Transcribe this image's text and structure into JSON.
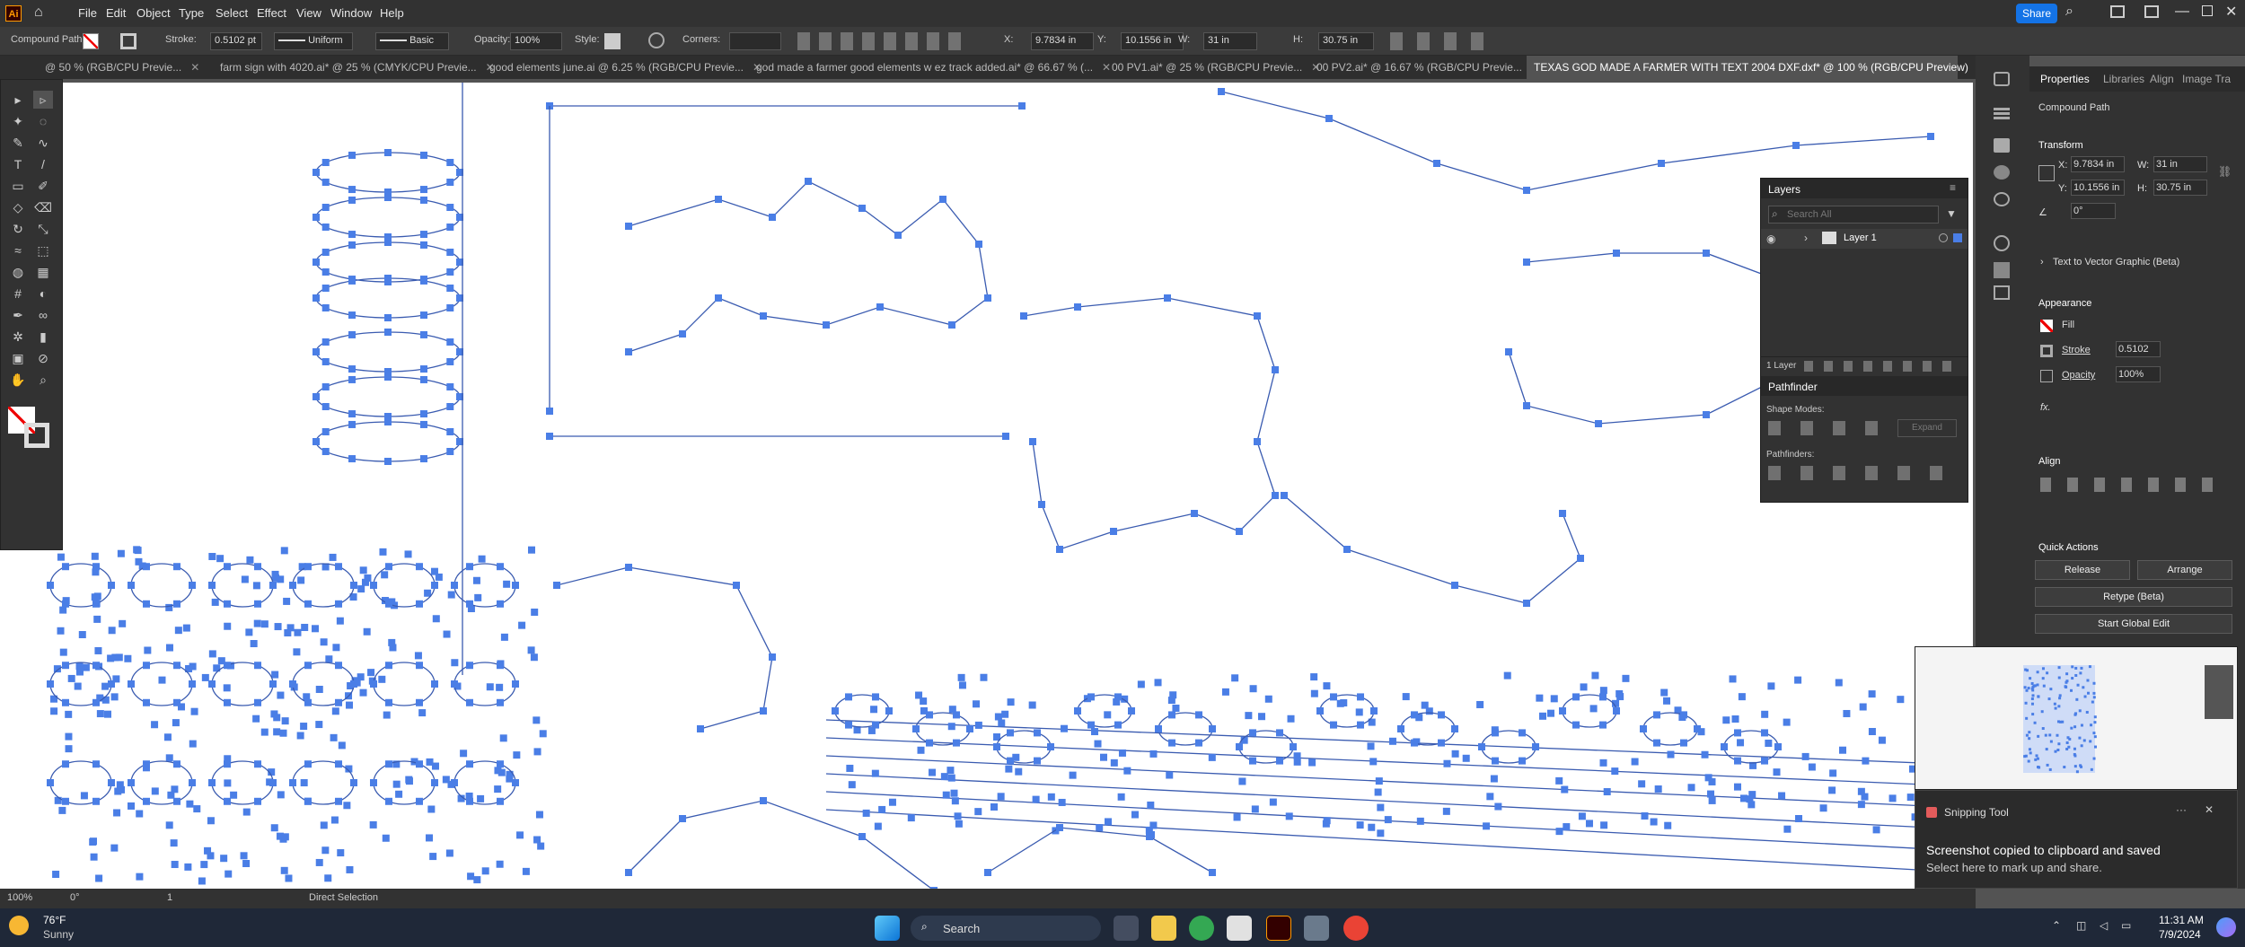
{
  "menu": {
    "app_logo": "Ai",
    "items": [
      "File",
      "Edit",
      "Object",
      "Type",
      "Select",
      "Effect",
      "View",
      "Window",
      "Help"
    ],
    "share_label": "Share"
  },
  "control_bar": {
    "object_type": "Compound Path",
    "stroke_label": "Stroke:",
    "stroke_value": "0.5102 pt",
    "uniform_label": "Uniform",
    "basic_label": "Basic",
    "opacity_label": "Opacity:",
    "opacity_value": "100%",
    "style_label": "Style:",
    "corners_label": "Corners:",
    "x_label": "X:",
    "x_value": "9.7834 in",
    "y_label": "Y:",
    "y_value": "10.1556 in",
    "w_label": "W:",
    "w_value": "31 in",
    "h_label": "H:",
    "h_value": "30.75 in"
  },
  "tabs": [
    {
      "label": "@ 50 % (RGB/CPU Previe..."
    },
    {
      "label": "farm sign with 4020.ai* @ 25 % (CMYK/CPU Previe..."
    },
    {
      "label": "good elements june.ai @ 6.25 % (RGB/CPU Previe..."
    },
    {
      "label": "god made a farmer good elements w ez track added.ai* @ 66.67 % (..."
    },
    {
      "label": "00 PV1.ai* @ 25 % (RGB/CPU Previe..."
    },
    {
      "label": "00 PV2.ai* @ 16.67 % (RGB/CPU Previe..."
    },
    {
      "label": "TEXAS GOD MADE A FARMER WITH TEXT 2004 DXF.dxf* @ 100 % (RGB/CPU Preview)"
    }
  ],
  "tools": [
    "selection-tool",
    "direct-selection-tool",
    "magic-wand-tool",
    "lasso-tool",
    "pen-tool",
    "curvature-tool",
    "type-tool",
    "line-tool",
    "rectangle-tool",
    "paintbrush-tool",
    "shaper-tool",
    "eraser-tool",
    "rotate-tool",
    "scale-tool",
    "width-tool",
    "free-transform-tool",
    "shape-builder-tool",
    "perspective-tool",
    "mesh-tool",
    "gradient-tool",
    "eyedropper-tool",
    "blend-tool",
    "symbol-sprayer-tool",
    "column-graph-tool",
    "artboard-tool",
    "slice-tool",
    "hand-tool",
    "zoom-tool"
  ],
  "status": {
    "zoom": "100%",
    "rotation": "0°",
    "artboard": "1",
    "tool_name": "Direct Selection"
  },
  "properties": {
    "tabs": [
      "Properties",
      "Libraries",
      "Align",
      "Image Tra"
    ],
    "object_type": "Compound Path",
    "transform_title": "Transform",
    "x_label": "X:",
    "x_value": "9.7834 in",
    "y_label": "Y:",
    "y_value": "10.1556 in",
    "w_label": "W:",
    "w_value": "31 in",
    "h_label": "H:",
    "h_value": "30.75 in",
    "angle_value": "0°",
    "text_to_vector": "Text to Vector Graphic (Beta)",
    "appearance_title": "Appearance",
    "fill_label": "Fill",
    "stroke_label": "Stroke",
    "stroke_value": "0.5102",
    "opacity_label": "Opacity",
    "opacity_value": "100%",
    "fx_label": "fx.",
    "align_title": "Align",
    "quick_actions_title": "Quick Actions",
    "release_label": "Release",
    "arrange_label": "Arrange",
    "retype_label": "Retype (Beta)",
    "global_edit_label": "Start Global Edit"
  },
  "layers": {
    "title": "Layers",
    "search_placeholder": "Search All",
    "layer_name": "Layer 1",
    "count": "1 Layer"
  },
  "pathfinder": {
    "title": "Pathfinder",
    "shape_modes": "Shape Modes:",
    "pathfinders": "Pathfinders:",
    "expand_label": "Expand"
  },
  "toast": {
    "app": "Snipping Tool",
    "title": "Screenshot copied to clipboard and saved",
    "body": "Select here to mark up and share."
  },
  "taskbar": {
    "weather_temp": "76°F",
    "weather_desc": "Sunny",
    "search_label": "Search",
    "time": "11:31 AM",
    "date": "7/9/2024"
  },
  "colors": {
    "anchor": "#4a7ee6",
    "path": "#3a5bb0",
    "accent": "#1473e6"
  }
}
